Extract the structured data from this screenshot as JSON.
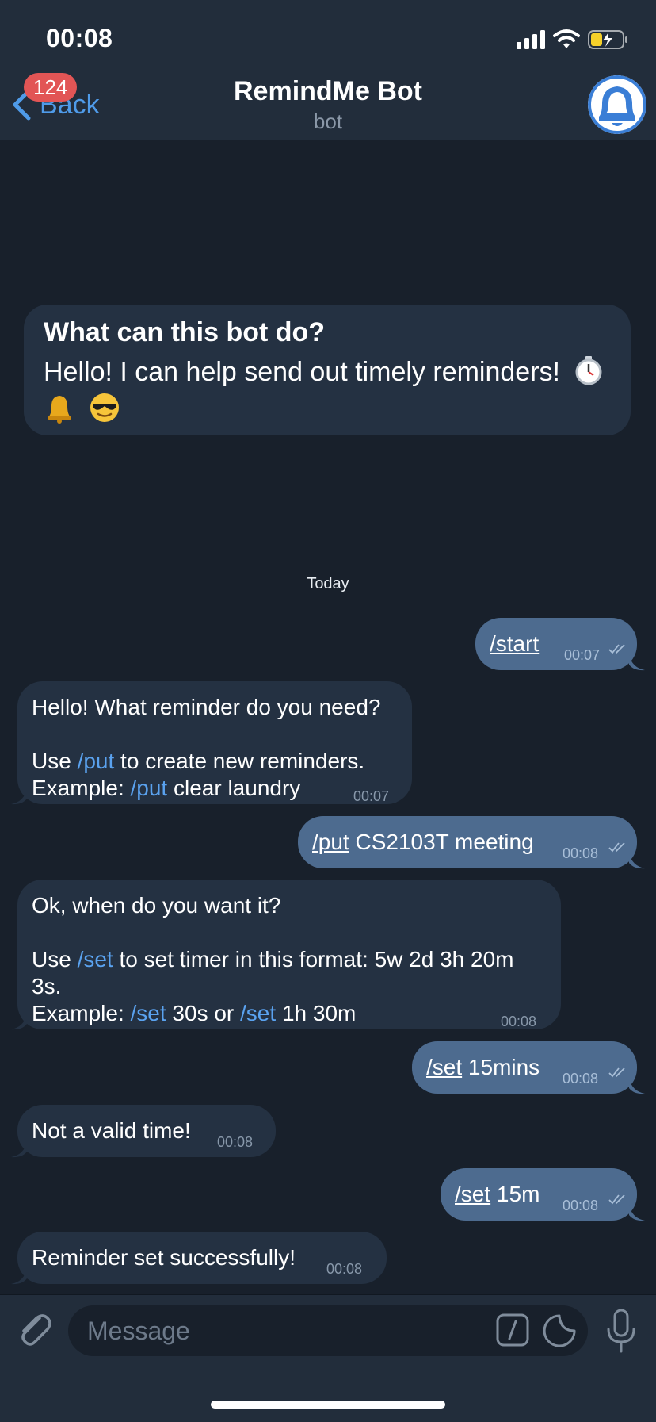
{
  "status_bar": {
    "time": "00:08"
  },
  "header": {
    "back_label": "Back",
    "unread_count": "124",
    "title": "RemindMe Bot",
    "subtitle": "bot"
  },
  "info_card": {
    "title": "What can this bot do?",
    "body": "Hello! I can help send out timely reminders!"
  },
  "date_separator": "Today",
  "messages": [
    {
      "side": "out",
      "cmd": "/start",
      "rest": "",
      "time": "00:07"
    },
    {
      "side": "in",
      "line1": "Hello! What reminder do you need?",
      "line2_pre": "Use ",
      "line2_cmd": "/put",
      "line2_post": " to create new reminders.",
      "line3_pre": "Example: ",
      "line3_cmd": "/put",
      "line3_post": " clear laundry",
      "time": "00:07"
    },
    {
      "side": "out",
      "cmd": "/put",
      "rest": " CS2103T meeting",
      "time": "00:08"
    },
    {
      "side": "in",
      "line1": "Ok, when do you want it?",
      "line2_pre": "Use ",
      "line2_cmd": "/set",
      "line2_post": " to set timer in this format: 5w 2d 3h 20m",
      "line3": "3s.",
      "line4_pre": "Example: ",
      "line4_cmd1": "/set",
      "line4_mid": " 30s or ",
      "line4_cmd2": "/set",
      "line4_post": " 1h 30m",
      "time": "00:08"
    },
    {
      "side": "out",
      "cmd": "/set",
      "rest": " 15mins",
      "time": "00:08"
    },
    {
      "side": "in",
      "text": "Not a valid time!",
      "time": "00:08"
    },
    {
      "side": "out",
      "cmd": "/set",
      "rest": " 15m",
      "time": "00:08"
    },
    {
      "side": "in",
      "text": "Reminder set successfully!",
      "time": "00:08"
    }
  ],
  "input": {
    "placeholder": "Message"
  },
  "colors": {
    "accent": "#4f9be9",
    "badge": "#e25555",
    "outgoing": "#4d6b8f",
    "incoming": "#243142"
  }
}
